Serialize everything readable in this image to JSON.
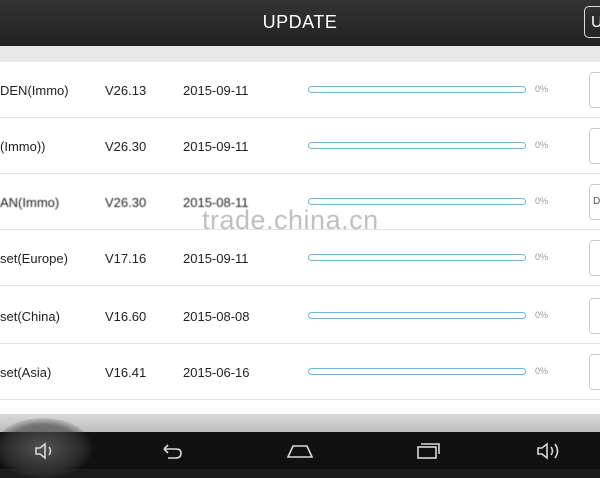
{
  "header": {
    "title": "UPDATE",
    "corner_button_label": "U"
  },
  "watermark": "trade.china.cn",
  "rows": [
    {
      "name": "DEN(Immo)",
      "version": "V26.13",
      "date": "2015-09-11",
      "progress_label": "0%",
      "progress": 0,
      "button_label": ""
    },
    {
      "name": "(Immo))",
      "version": "V26.30",
      "date": "2015-09-11",
      "progress_label": "0%",
      "progress": 0,
      "button_label": ""
    },
    {
      "name": "AN(Immo)",
      "version": "V26.30",
      "date": "2015-08-11",
      "progress_label": "0%",
      "progress": 0,
      "button_label": "D"
    },
    {
      "name": "set(Europe)",
      "version": "V17.16",
      "date": "2015-09-11",
      "progress_label": "0%",
      "progress": 0,
      "button_label": ""
    },
    {
      "name": "set(China)",
      "version": "V16.60",
      "date": "2015-08-08",
      "progress_label": "0%",
      "progress": 0,
      "button_label": ""
    },
    {
      "name": "set(Asia)",
      "version": "V16.41",
      "date": "2015-06-16",
      "progress_label": "0%",
      "progress": 0,
      "button_label": ""
    }
  ],
  "navbar": {
    "icons": [
      "volume-down-icon",
      "back-icon",
      "home-icon",
      "recent-apps-icon",
      "volume-up-icon"
    ]
  },
  "colors": {
    "progress_accent": "#6fb7d8",
    "topbar": "#2a2a2a",
    "navbar": "#111111"
  }
}
